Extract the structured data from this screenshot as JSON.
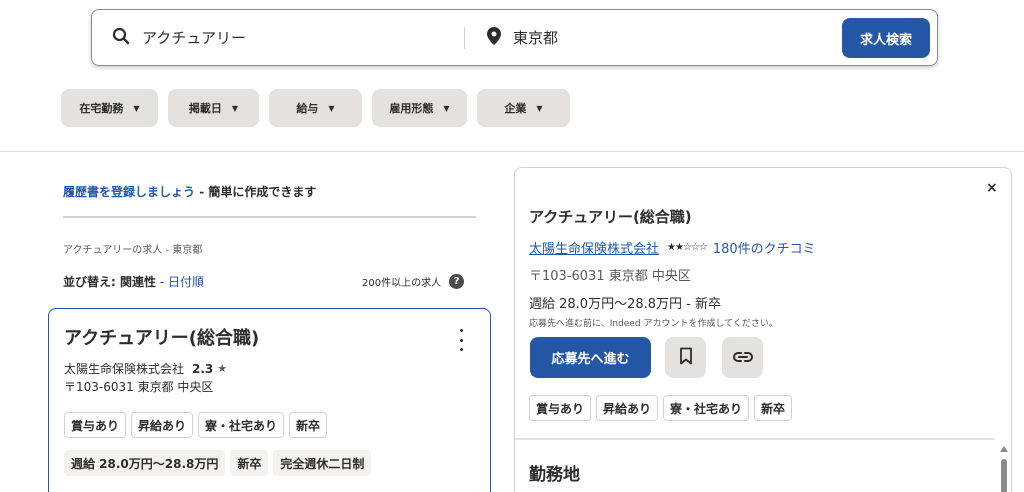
{
  "search": {
    "what_value": "アクチュアリー",
    "where_value": "東京都",
    "button_label": "求人検索"
  },
  "filters": [
    {
      "label": "在宅勤務"
    },
    {
      "label": "掲載日"
    },
    {
      "label": "給与"
    },
    {
      "label": "雇用形態"
    },
    {
      "label": "企業"
    }
  ],
  "left": {
    "resume_link": "履歴書を登録しましょう",
    "resume_text": " - 簡単に作成できます",
    "breadcrumb": "アクチュアリーの求人 - 東京都",
    "sort_prefix": "並び替え: ",
    "sort_active": "関連性",
    "sort_separator": " - ",
    "sort_alt": "日付順",
    "job_count": "200件以上の求人",
    "help_glyph": "?"
  },
  "card": {
    "title": "アクチュアリー(総合職)",
    "company": "太陽生命保険株式会社",
    "rating": "2.3",
    "address": "〒103-6031 東京都 中央区",
    "tags_row1": [
      "賞与あり",
      "昇給あり",
      "寮・社宅あり",
      "新卒"
    ],
    "tags_row2": [
      "週給 28.0万円～28.8万円",
      "新卒",
      "完全週休二日制"
    ]
  },
  "detail": {
    "close": "×",
    "title": "アクチュアリー(総合職)",
    "company": "太陽生命保険株式会社",
    "stars": "★★☆☆☆",
    "rating_value": 2.3,
    "reviews": "180件のクチコミ",
    "address": "〒103-6031 東京都 中央区",
    "salary": "週給 28.0万円～28.8万円  - 新卒",
    "note": "応募先へ進む前に、Indeed アカウントを作成してください。",
    "apply_label": "応募先へ進む",
    "tags": [
      "賞与あり",
      "昇給あり",
      "寮・社宅あり",
      "新卒"
    ],
    "section_heading": "勤務地"
  },
  "icons": {
    "search": "search-icon",
    "location": "location-pin-icon",
    "bookmark": "bookmark-icon",
    "link": "link-icon"
  },
  "colors": {
    "accent": "#2557a7",
    "chip_bg": "#e4e2e0",
    "text": "#2d2d2d"
  }
}
